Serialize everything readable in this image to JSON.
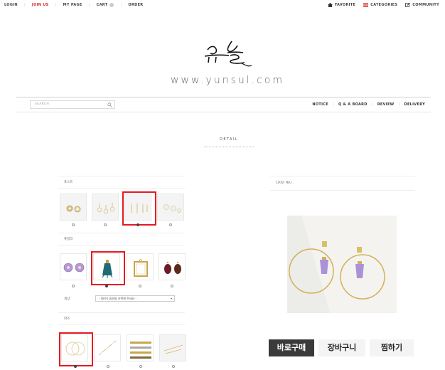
{
  "top_nav": {
    "login": "LOGIN",
    "join": "JOIN US",
    "mypage": "MY PAGE",
    "cart": "CART",
    "order": "ORDER"
  },
  "top_right": {
    "favorite": "FAVORITE",
    "categories": "CATEGORIES",
    "community": "COMMUNITY"
  },
  "logo_text": "윤슬",
  "site_url": "www.yunsul.com",
  "search": {
    "placeholder": "SEARCH"
  },
  "main_nav": [
    "NOTICE",
    "Q & A BOARD",
    "REVIEW",
    "DELIVERY"
  ],
  "detail_title": "DETAIL",
  "option_groups": [
    {
      "label": "포스트",
      "selected_index": 2
    },
    {
      "label": "쥬얼리",
      "selected_index": 1
    },
    {
      "label": "파츠",
      "selected_index": 0
    }
  ],
  "select_row": {
    "label": "색상",
    "value": "- [필수] 옵션을 선택해 주세요 -"
  },
  "product_name": "디자인 예시",
  "buttons": {
    "buy": "바로구매",
    "cart": "장바구니",
    "wish": "찜하기"
  },
  "colors": {
    "accent_red": "#d9262a",
    "selection_red": "#e31b23",
    "buy_button": "#3a3a3a"
  }
}
